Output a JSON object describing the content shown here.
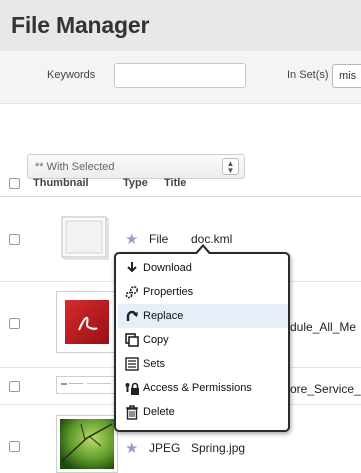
{
  "page": {
    "title": "File Manager"
  },
  "filters": {
    "keywords_label": "Keywords",
    "keywords_value": "",
    "inset_label": "In Set(s)",
    "inset_value": "mis"
  },
  "bulk": {
    "label": "** With Selected"
  },
  "table": {
    "headers": {
      "thumbnail": "Thumbnail",
      "type": "Type",
      "title": "Title"
    },
    "rows": [
      {
        "type": "File",
        "title": "doc.kml",
        "thumb": "document-icon"
      },
      {
        "type": "",
        "title": "dule_All_Me",
        "thumb": "pdf-thumbnail"
      },
      {
        "type": "",
        "title": "ore_Service_",
        "thumb": "document-strip-thumbnail"
      },
      {
        "type": "JPEG",
        "title": "Spring.jpg",
        "thumb": "spring-photo-thumbnail"
      }
    ]
  },
  "context_menu": {
    "items": [
      {
        "label": "Download",
        "icon": "download-icon"
      },
      {
        "label": "Properties",
        "icon": "gears-icon"
      },
      {
        "label": "Replace",
        "icon": "replace-icon"
      },
      {
        "label": "Copy",
        "icon": "copy-icon"
      },
      {
        "label": "Sets",
        "icon": "list-icon"
      },
      {
        "label": "Access & Permissions",
        "icon": "lock-icon"
      },
      {
        "label": "Delete",
        "icon": "trash-icon"
      }
    ],
    "highlighted_index": 2
  },
  "colors": {
    "header_bg": "#e8e8e8",
    "menu_border": "#2b2b2b",
    "menu_highlight": "#e6eef8",
    "star": "#a597c8"
  }
}
